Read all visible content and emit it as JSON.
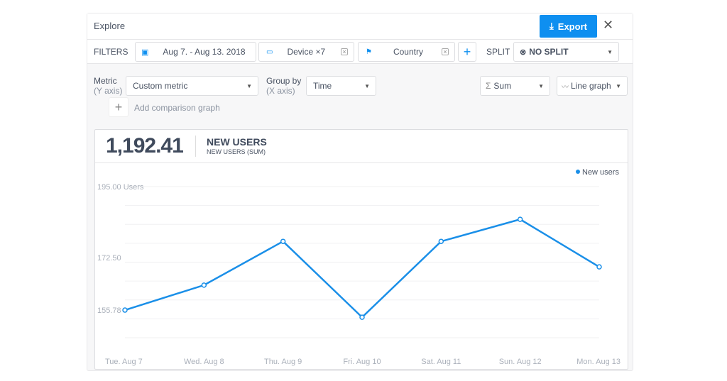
{
  "header": {
    "title": "Explore",
    "export_label": "Export",
    "close_icon": "close-icon"
  },
  "filters": {
    "label": "FILTERS",
    "date": "Aug 7. - Aug 13. 2018",
    "device": "Device ×7",
    "country": "Country",
    "split_label": "SPLIT",
    "split_value": "NO SPLIT"
  },
  "controls": {
    "metric_label": "Metric",
    "metric_sub": "(Y axis)",
    "metric_value": "Custom metric",
    "group_label": "Group by",
    "group_sub": "(X axis)",
    "group_value": "Time",
    "agg_value": "Sum",
    "graph_value": "Line graph",
    "add_comparison": "Add comparison graph"
  },
  "summary": {
    "total": "1,192.41",
    "metric_title": "NEW USERS",
    "metric_sub": "NEW USERS (SUM)"
  },
  "chart_data": {
    "type": "line",
    "categories": [
      "Tue. Aug 7",
      "Wed. Aug 8",
      "Thu. Aug 9",
      "Fri. Aug 10",
      "Sat. Aug 11",
      "Sun. Aug 12",
      "Mon. Aug 13"
    ],
    "series": [
      {
        "name": "New users",
        "values": [
          155.78,
          163.7,
          177.6,
          153.5,
          177.6,
          184.6,
          169.5
        ],
        "color": "#1a8fe8"
      }
    ],
    "yticks": [
      "195.00",
      "172.50",
      "155.78"
    ],
    "ytick_values": [
      195,
      172.5,
      155.78
    ],
    "yunit": "Users",
    "ylim": [
      147,
      195
    ],
    "grid": true,
    "legend": "top-right"
  },
  "colors": {
    "accent": "#0e8ff0"
  }
}
